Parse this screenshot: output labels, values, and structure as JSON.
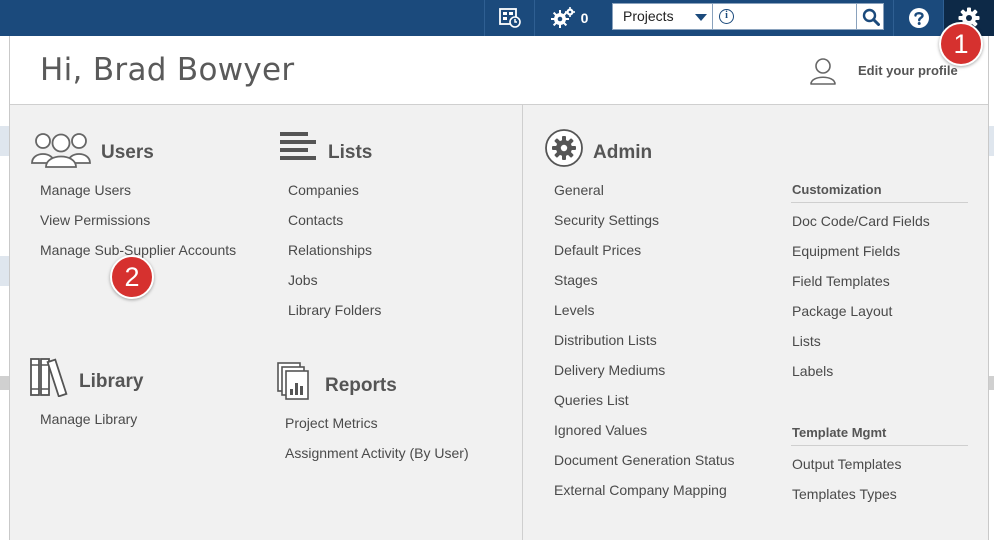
{
  "topbar": {
    "jobs_count": "0",
    "search": {
      "scope": "Projects",
      "query": ""
    },
    "icons": [
      "schedule-icon",
      "gears-icon",
      "info-icon",
      "search-icon",
      "help-icon",
      "settings-gear-icon"
    ]
  },
  "profile": {
    "greeting": "Hi, Brad Bowyer",
    "edit_label": "Edit your profile"
  },
  "users": {
    "title": "Users",
    "items": [
      "Manage Users",
      "View Permissions",
      "Manage Sub-Supplier Accounts"
    ]
  },
  "lists": {
    "title": "Lists",
    "items": [
      "Companies",
      "Contacts",
      "Relationships",
      "Jobs",
      "Library Folders"
    ]
  },
  "library": {
    "title": "Library",
    "items": [
      "Manage Library"
    ]
  },
  "reports": {
    "title": "Reports",
    "items": [
      "Project Metrics",
      "Assignment Activity (By User)"
    ]
  },
  "admin": {
    "title": "Admin",
    "items": [
      "General",
      "Security Settings",
      "Default Prices",
      "Stages",
      "Levels",
      "Distribution Lists",
      "Delivery Mediums",
      "Queries List",
      "Ignored Values",
      "Document Generation Status",
      "External Company Mapping"
    ],
    "customization": {
      "title": "Customization",
      "items": [
        "Doc Code/Card Fields",
        "Equipment Fields",
        "Field Templates",
        "Package Layout",
        "Lists",
        "Labels"
      ]
    },
    "template_mgmt": {
      "title": "Template Mgmt",
      "items": [
        "Output Templates",
        "Templates Types"
      ]
    }
  },
  "callouts": [
    "1",
    "2"
  ],
  "colors": {
    "topbar": "#1b4a7c",
    "badge": "#d6312f",
    "panel": "#f1f1f1"
  }
}
